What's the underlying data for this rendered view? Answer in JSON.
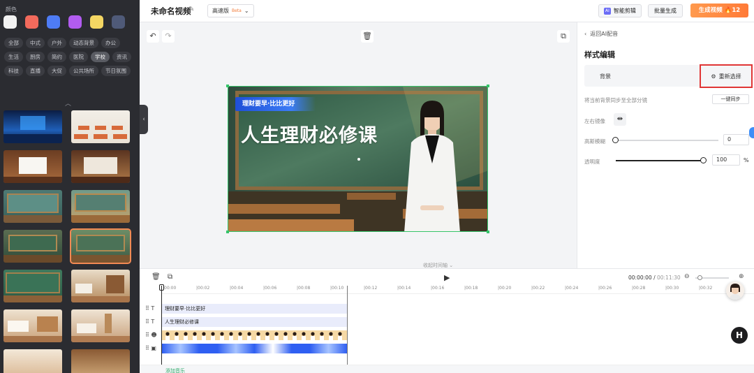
{
  "left_panel": {
    "section_label": "颜色",
    "swatches": [
      "#f2f2f2",
      "#f26a5c",
      "#4e7cf5",
      "#b25cf0",
      "#f4d663",
      "#4f5a78"
    ],
    "tags": [
      "全部",
      "中式",
      "户外",
      "动态背景",
      "办公",
      "生活",
      "厨房",
      "简约",
      "医院",
      "学校",
      "资讯",
      "科技",
      "直播",
      "大促",
      "公共场所",
      "节日氛围"
    ],
    "active_tag": "学校"
  },
  "topbar": {
    "title": "未命名视频",
    "mode": "高速版",
    "mode_badge": "Beta",
    "smart_label": "智能剪辑",
    "smart_badge": "AI",
    "batch_label": "批量生成",
    "generate_label": "生成视频",
    "credits": "12"
  },
  "stage": {
    "banner_text": "理财要早·比比更好",
    "headline": "人生理财必修课",
    "collapse_label": "收起时间轴"
  },
  "right_panel": {
    "back_label": "返回AI配音",
    "title": "样式编辑",
    "bg_label": "背景",
    "reselect_label": "重新选择",
    "sync_label": "将当前背景同步至全部分镜",
    "sync_button": "一键同步",
    "mirror_label": "左右镜像",
    "blur_label": "高斯模糊",
    "blur_value": "0",
    "opacity_label": "透明度",
    "opacity_value": "100",
    "opacity_unit": "%"
  },
  "timeline": {
    "time_current": "00:00:00",
    "time_separator": " / ",
    "time_total": "00:11:30",
    "ticks": [
      "00:00",
      "00:02",
      "00:04",
      "00:06",
      "00:08",
      "00:10",
      "00:12",
      "00:14",
      "00:16",
      "00:18",
      "00:20",
      "00:22",
      "00:24",
      "00:26",
      "00:28",
      "00:30",
      "00:32"
    ],
    "tracks": {
      "subtitle": "理财要早·比比更好",
      "title": "人生理财必修课"
    },
    "music_label": "添加音乐"
  },
  "icons": {
    "credit": "flame-icon",
    "play": "play-icon"
  }
}
